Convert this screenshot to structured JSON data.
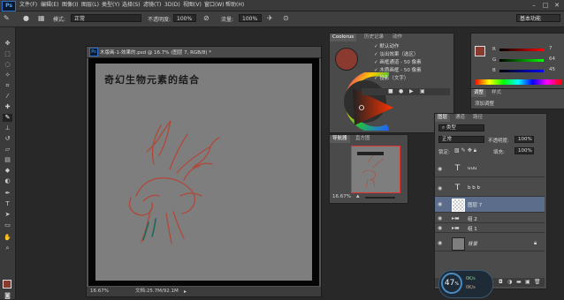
{
  "app": {
    "logo": "Ps"
  },
  "menu": [
    "文件(F)",
    "编辑(E)",
    "图像(I)",
    "图层(L)",
    "类型(Y)",
    "选择(S)",
    "滤镜(T)",
    "3D(D)",
    "视图(V)",
    "窗口(W)",
    "帮助(H)"
  ],
  "window_controls": [
    "–",
    "□",
    "✕"
  ],
  "options": {
    "mode_label": "模式:",
    "mode_value": "正常",
    "opacity_label": "不透明度:",
    "opacity_value": "100%",
    "flow_label": "流量:",
    "flow_value": "100%",
    "workspace": "基本功能"
  },
  "document": {
    "tab_title": "木版画-1-效果的.psd @ 16.7% (图层 7, RGB/8) *",
    "canvas_title": "奇幻生物元素的结合",
    "zoom": "16.67%",
    "doc_size": "文档:25.7M/92.1M"
  },
  "color_panel": {
    "tabs": [
      "Coolorus",
      "历史记录",
      "动作"
    ],
    "actions": [
      "默认动作",
      "淡出效果（选区）",
      "画框通道 - 50 像素",
      "木质画框 - 50 像素",
      "投影（文字）"
    ]
  },
  "navigator": {
    "tabs": [
      "导航器",
      "直方图"
    ],
    "zoom": "16.67%"
  },
  "swatch_panel": {
    "values": [
      "7",
      "64",
      "45"
    ]
  },
  "adjustments": {
    "tabs": [
      "调整",
      "样式"
    ],
    "label": "添加调整"
  },
  "layers": {
    "tabs": [
      "图层",
      "通道",
      "路径"
    ],
    "kind_filter": "类型",
    "blend_mode": "正常",
    "opacity_label": "不透明度:",
    "opacity_value": "100%",
    "lock_label": "锁定:",
    "fill_label": "填充:",
    "fill_value": "100%",
    "items": [
      {
        "type": "text",
        "name": "uuu"
      },
      {
        "type": "text",
        "name": "b b b"
      },
      {
        "type": "pixel",
        "name": "图层 7",
        "selected": true
      },
      {
        "type": "group",
        "name": "组 2"
      },
      {
        "type": "group",
        "name": "组 1"
      },
      {
        "type": "background",
        "name": "背景"
      }
    ]
  },
  "perf_widget": {
    "value": "47",
    "unit": "%",
    "up": "0K/s",
    "down": "0K/s"
  },
  "colors": {
    "foreground": "#8a3a2e",
    "sketch": "#b0493a",
    "accent_teal": "#1e6a5a",
    "selected_layer": "#5b6d8a"
  }
}
